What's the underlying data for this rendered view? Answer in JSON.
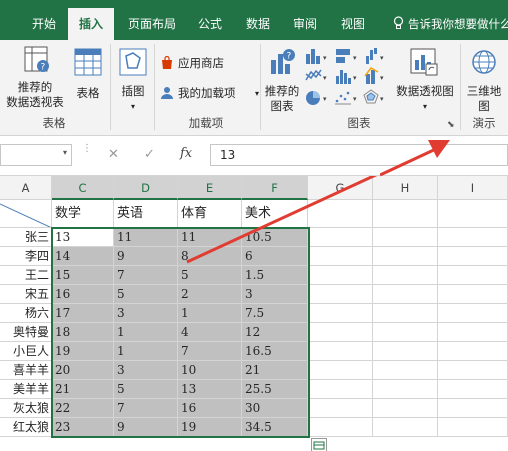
{
  "tabs": [
    {
      "label": "开始",
      "active": false
    },
    {
      "label": "插入",
      "active": true
    },
    {
      "label": "页面布局",
      "active": false
    },
    {
      "label": "公式",
      "active": false
    },
    {
      "label": "数据",
      "active": false
    },
    {
      "label": "审阅",
      "active": false
    },
    {
      "label": "视图",
      "active": false
    }
  ],
  "tell_me": "告诉我你想要做什么",
  "ribbon": {
    "tables": {
      "group_label": "表格",
      "recommended_pivot": [
        "推荐的",
        "数据透视表"
      ],
      "table": "表格"
    },
    "illustrations": {
      "label": "插图"
    },
    "addins": {
      "group_label": "加载项",
      "store": "应用商店",
      "my_addins": "我的加载项"
    },
    "charts": {
      "group_label": "图表",
      "recommended_charts": [
        "推荐的",
        "图表"
      ],
      "pivot_chart": "数据透视图"
    },
    "tours": {
      "group_label": "演示",
      "map3d": [
        "三维地",
        "图"
      ]
    }
  },
  "formula_bar": {
    "cancel": "✕",
    "enter": "✓",
    "fx": "fx",
    "value": "13"
  },
  "columns": [
    "A",
    "C",
    "D",
    "E",
    "F",
    "G",
    "H",
    "I"
  ],
  "table": {
    "headers": [
      "数学",
      "英语",
      "体育",
      "美术"
    ],
    "names": [
      "张三",
      "李四",
      "王二",
      "宋五",
      "杨六",
      "奥特曼",
      "小巨人",
      "喜羊羊",
      "美羊羊",
      "灰太狼",
      "红太狼"
    ],
    "rows": [
      [
        "13",
        "11",
        "11",
        "10.5"
      ],
      [
        "14",
        "9",
        "8",
        "6"
      ],
      [
        "15",
        "7",
        "5",
        "1.5"
      ],
      [
        "16",
        "5",
        "2",
        "3"
      ],
      [
        "17",
        "3",
        "1",
        "7.5"
      ],
      [
        "18",
        "1",
        "4",
        "12"
      ],
      [
        "19",
        "1",
        "7",
        "16.5"
      ],
      [
        "20",
        "3",
        "10",
        "21"
      ],
      [
        "21",
        "5",
        "13",
        "25.5"
      ],
      [
        "22",
        "7",
        "16",
        "30"
      ],
      [
        "23",
        "9",
        "19",
        "34.5"
      ]
    ]
  },
  "colors": {
    "accent": "#217346",
    "arrow": "#e03c31",
    "selection_fill": "#c0c0c0"
  }
}
